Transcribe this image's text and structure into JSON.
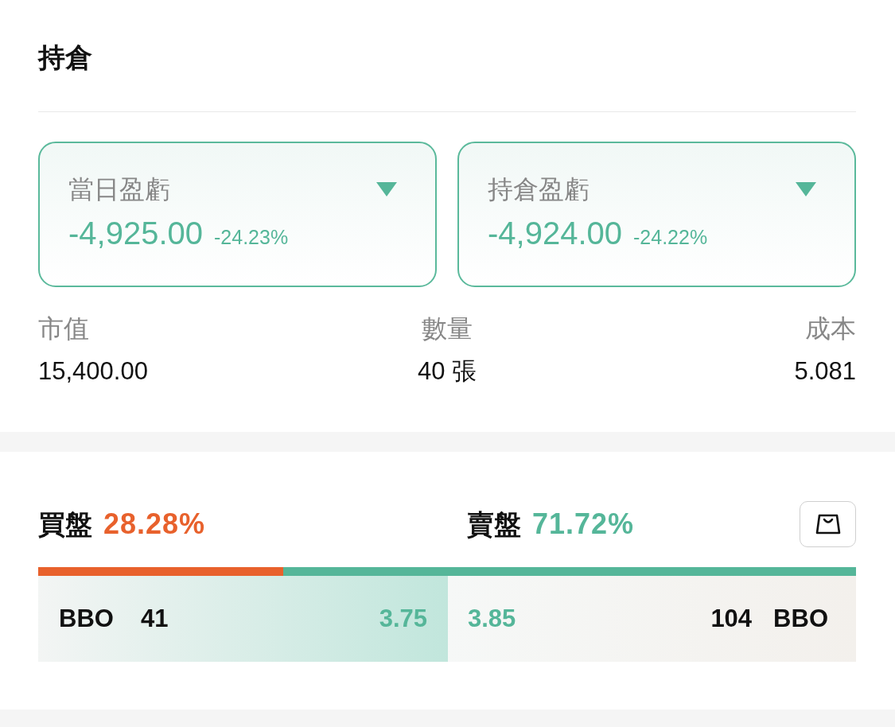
{
  "section_title": "持倉",
  "pnl_cards": [
    {
      "label": "當日盈虧",
      "value": "-4,925.00",
      "percent": "-24.23%"
    },
    {
      "label": "持倉盈虧",
      "value": "-4,924.00",
      "percent": "-24.22%"
    }
  ],
  "stats": [
    {
      "label": "市值",
      "value": "15,400.00"
    },
    {
      "label": "數量",
      "value": "40 張"
    },
    {
      "label": "成本",
      "value": "5.081"
    }
  ],
  "order_book": {
    "bid": {
      "label": "買盤",
      "percent": "28.28%"
    },
    "ask": {
      "label": "賣盤",
      "percent": "71.72%"
    },
    "ratio_bar": {
      "level": 0.3
    },
    "bid_row": {
      "tag": "BBO",
      "volume": "41",
      "price": "3.75"
    },
    "ask_row": {
      "price": "3.85",
      "volume": "104",
      "tag": "BBO"
    }
  }
}
